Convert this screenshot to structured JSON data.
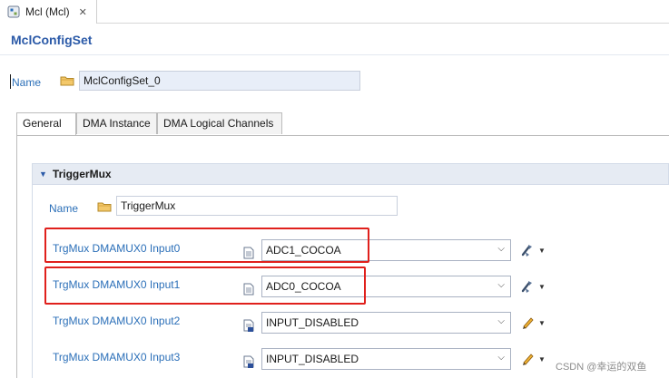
{
  "editor_tab": {
    "label": "Mcl (Mcl)",
    "close": "✕"
  },
  "header": {
    "title": "MclConfigSet"
  },
  "config_name": {
    "label": "Name",
    "value": "MclConfigSet_0"
  },
  "tabs": [
    {
      "label": "General",
      "active": true
    },
    {
      "label": "DMA Instance",
      "active": false
    },
    {
      "label": "DMA Logical Channels",
      "active": false
    }
  ],
  "section": {
    "title": "TriggerMux",
    "name_label": "Name",
    "name_value": "TriggerMux"
  },
  "rows": [
    {
      "label": "TrgMux DMAMUX0 Input0",
      "value": "ADC1_COCOA",
      "tool": "wand-icon",
      "highlighted": true
    },
    {
      "label": "TrgMux DMAMUX0 Input1",
      "value": "ADC0_COCOA",
      "tool": "wand-icon",
      "highlighted": true
    },
    {
      "label": "TrgMux DMAMUX0 Input2",
      "value": "INPUT_DISABLED",
      "tool": "pencil-icon",
      "highlighted": false
    },
    {
      "label": "TrgMux DMAMUX0 Input3",
      "value": "INPUT_DISABLED",
      "tool": "pencil-icon",
      "highlighted": false
    }
  ],
  "watermark": "CSDN @幸运的双鱼",
  "colors": {
    "link": "#2b6fb8",
    "title": "#2b5aa8",
    "highlight": "#e0201c",
    "section_bg": "#e6ebf3"
  }
}
